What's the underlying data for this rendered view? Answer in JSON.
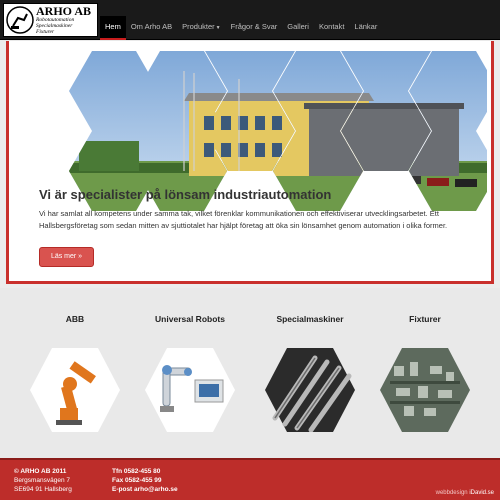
{
  "brand": {
    "title": "ARHO AB",
    "subtitle_lines": [
      "Robotautomation",
      "Specialmaskiner",
      "Fixturer"
    ]
  },
  "nav": {
    "items": [
      {
        "label": "Hem",
        "active": true
      },
      {
        "label": "Om Arho AB",
        "active": false
      },
      {
        "label": "Produkter",
        "active": false,
        "dropdown": true
      },
      {
        "label": "Frågor & Svar",
        "active": false
      },
      {
        "label": "Galleri",
        "active": false
      },
      {
        "label": "Kontakt",
        "active": false
      },
      {
        "label": "Länkar",
        "active": false
      }
    ]
  },
  "hero": {
    "title": "Vi är specialister på lönsam industriautomation",
    "text": "Vi har samlat all kompetens under samma tak, vilket förenklar kommunikationen och effektiviserar utvecklingsarbetet. Ett Hallsbergsföretag som sedan mitten av sjuttiotalet har hjälpt företag att öka sin lönsamhet genom automation i olika former.",
    "button": "Läs mer »"
  },
  "categories": [
    {
      "title": "ABB"
    },
    {
      "title": "Universal Robots"
    },
    {
      "title": "Specialmaskiner"
    },
    {
      "title": "Fixturer"
    }
  ],
  "footer": {
    "company": "© ARHO AB 2011",
    "street": "Bergsmansvägen 7",
    "city": "SE694 91 Hallsberg",
    "phone": "Tfn 0582-455 80",
    "fax": "Fax 0582-455 99",
    "email": "E-post arho@arho.se",
    "credit_prefix": "webbdesign",
    "credit_name": "iDavid.se"
  },
  "colors": {
    "accent": "#c9302c",
    "navbar": "#1a1a1a",
    "footer": "#bd2d2a"
  }
}
